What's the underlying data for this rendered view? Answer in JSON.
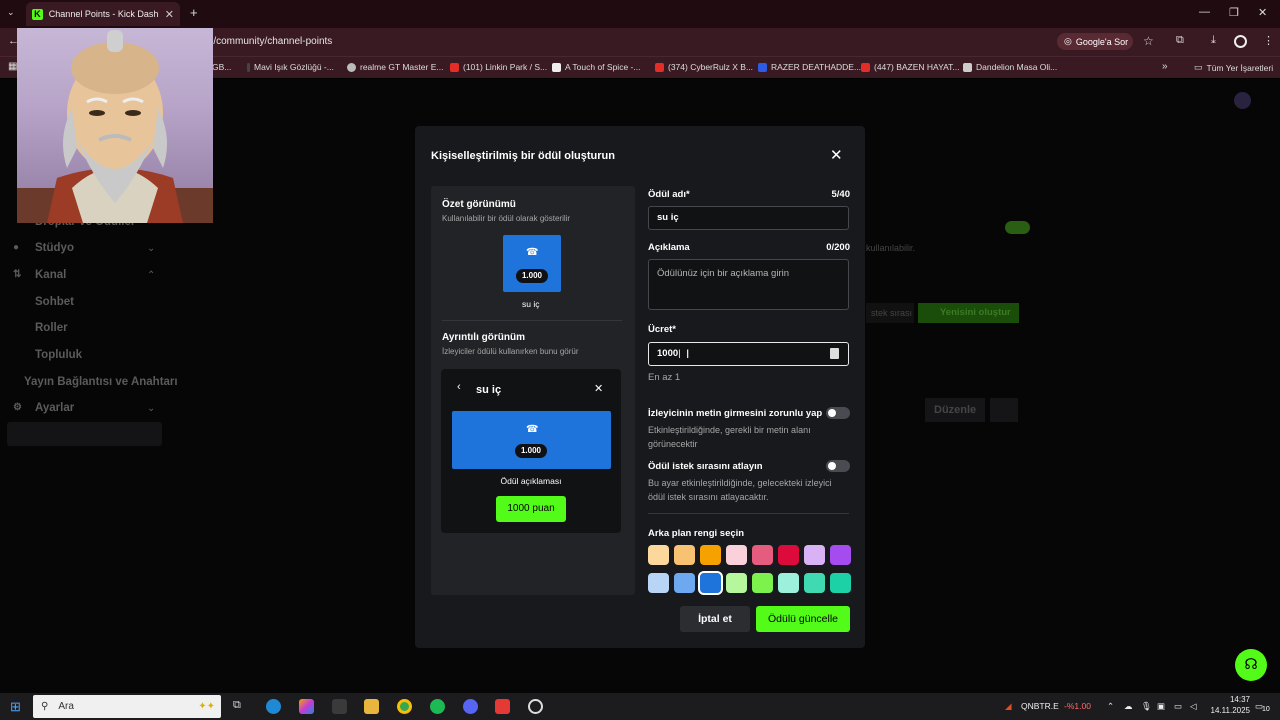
{
  "browser": {
    "tab_title": "Channel Points - Kick Dashboard",
    "tab_favicon": "K",
    "url": "nel/community/channel-points",
    "google_sor": "Google'a Sor",
    "bookmarks": [
      {
        "label": "GB...",
        "icon_color": "#555"
      },
      {
        "label": "Mavi Işık Gözlüğü -...",
        "icon_color": "#444"
      },
      {
        "label": "realme GT Master E...",
        "icon_color": "#bbb"
      },
      {
        "label": "(101) Linkin Park / S...",
        "icon_color": "#e52d27"
      },
      {
        "label": "A Touch of Spice -...",
        "icon_color": "#eee"
      },
      {
        "label": "(374) CyberRulz X B...",
        "icon_color": "#e52d27"
      },
      {
        "label": "RAZER DEATHADDE...",
        "icon_color": "#2d5be3"
      },
      {
        "label": "(447) BAZEN HAYAT...",
        "icon_color": "#e52d27"
      },
      {
        "label": "Dandelion Masa Oli...",
        "icon_color": "#ccc"
      }
    ],
    "all_bookmarks": "Tüm Yer İşaretleri"
  },
  "sidebar": {
    "items": [
      {
        "label": "Droplar ve Ödüller"
      },
      {
        "label": "Stüdyo"
      },
      {
        "label": "Kanal"
      },
      {
        "label": "Sohbet"
      },
      {
        "label": "Roller"
      },
      {
        "label": "Topluluk"
      },
      {
        "label": "Yayın Bağlantısı ve Anahtarı"
      },
      {
        "label": "Ayarlar"
      }
    ]
  },
  "background": {
    "usable_text": "kullanılabilir.",
    "queue_btn": "stek sırası",
    "create_new": "Yenisini oluştur",
    "edit": "Düzenle"
  },
  "modal": {
    "title": "Kişiselleştirilmiş bir ödül oluşturun",
    "summary_head": "Özet görünümü",
    "summary_sub": "Kullanılabilir bir ödül olarak gösterilir",
    "cost_display": "1.000",
    "reward_name": "su iç",
    "detail_head": "Ayrıntılı görünüm",
    "detail_sub": "İzleyiciler ödülü kullanırken bunu görür",
    "reward_desc_label": "Ödül açıklaması",
    "points_button": "1000 puan",
    "name_label": "Ödül adı*",
    "name_counter": "5/40",
    "name_value": "su iç",
    "desc_label": "Açıklama",
    "desc_counter": "0/200",
    "desc_placeholder": "Ödülünüz için bir açıklama girin",
    "cost_label": "Ücret*",
    "cost_value": "1000",
    "cost_hint": "En az 1",
    "toggle1_label": "İzleyicinin metin girmesini zorunlu yap",
    "toggle1_desc": "Etkinleştirildiğinde, gerekli bir metin alanı görünecektir",
    "toggle2_label": "Ödül istek sırasını atlayın",
    "toggle2_desc": "Bu ayar etkinleştirildiğinde, gelecekteki izleyici ödül istek sırasını atlayacaktır.",
    "color_label": "Arka plan rengi seçin",
    "colors": [
      "#fcd89c",
      "#f9c273",
      "#f5a201",
      "#fad0da",
      "#e55c7e",
      "#dd0a3c",
      "#d9b2f6",
      "#a54cf1",
      "#b9d5f6",
      "#6ea8f0",
      "#1e74da",
      "#b6f79e",
      "#7ef24c",
      "#9df0dc",
      "#3fd9b2",
      "#1bd1a5"
    ],
    "selected_color": "#1e74da",
    "cancel": "İptal et",
    "save": "Ödülü güncelle"
  },
  "taskbar": {
    "search_placeholder": "Ara",
    "stock": "QNBTR.E",
    "stock_change": "-%1.00",
    "time": "14:37",
    "date": "14.11.2025",
    "notif_count": "10"
  }
}
